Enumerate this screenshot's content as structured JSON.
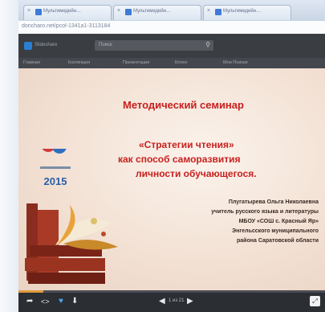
{
  "browser": {
    "tabs": [
      {
        "label": "Мультимедийн…"
      },
      {
        "label": "Мультимедийн…"
      },
      {
        "label": "Мультимедийн…"
      }
    ],
    "url": "doncharo.net/pcol-1341a1-3113184"
  },
  "site": {
    "logo_text": "Slideshare",
    "search_placeholder": "Поиск",
    "menu": [
      "Главная",
      "Коллекция",
      "Презентации",
      "Блоги",
      "Мои Поиски"
    ]
  },
  "slide": {
    "title": "Методический семинар",
    "quote_line1": "«Стратегии чтения»",
    "quote_line2": "как способ саморазвития",
    "quote_line3": "личности обучающегося.",
    "emblem_year": "2015",
    "author": [
      "Плугатырева Ольга Николаевна",
      "учитель русского языка и литературы",
      "МБОУ «СОШ с. Красный Яр»",
      "Энгельсского муниципального",
      "района Саратовской области"
    ]
  },
  "player": {
    "page_indicator": "1 из 21",
    "progress": 0.08
  },
  "colors": {
    "accent": "#c8201e",
    "progress": "#e19a3c"
  }
}
